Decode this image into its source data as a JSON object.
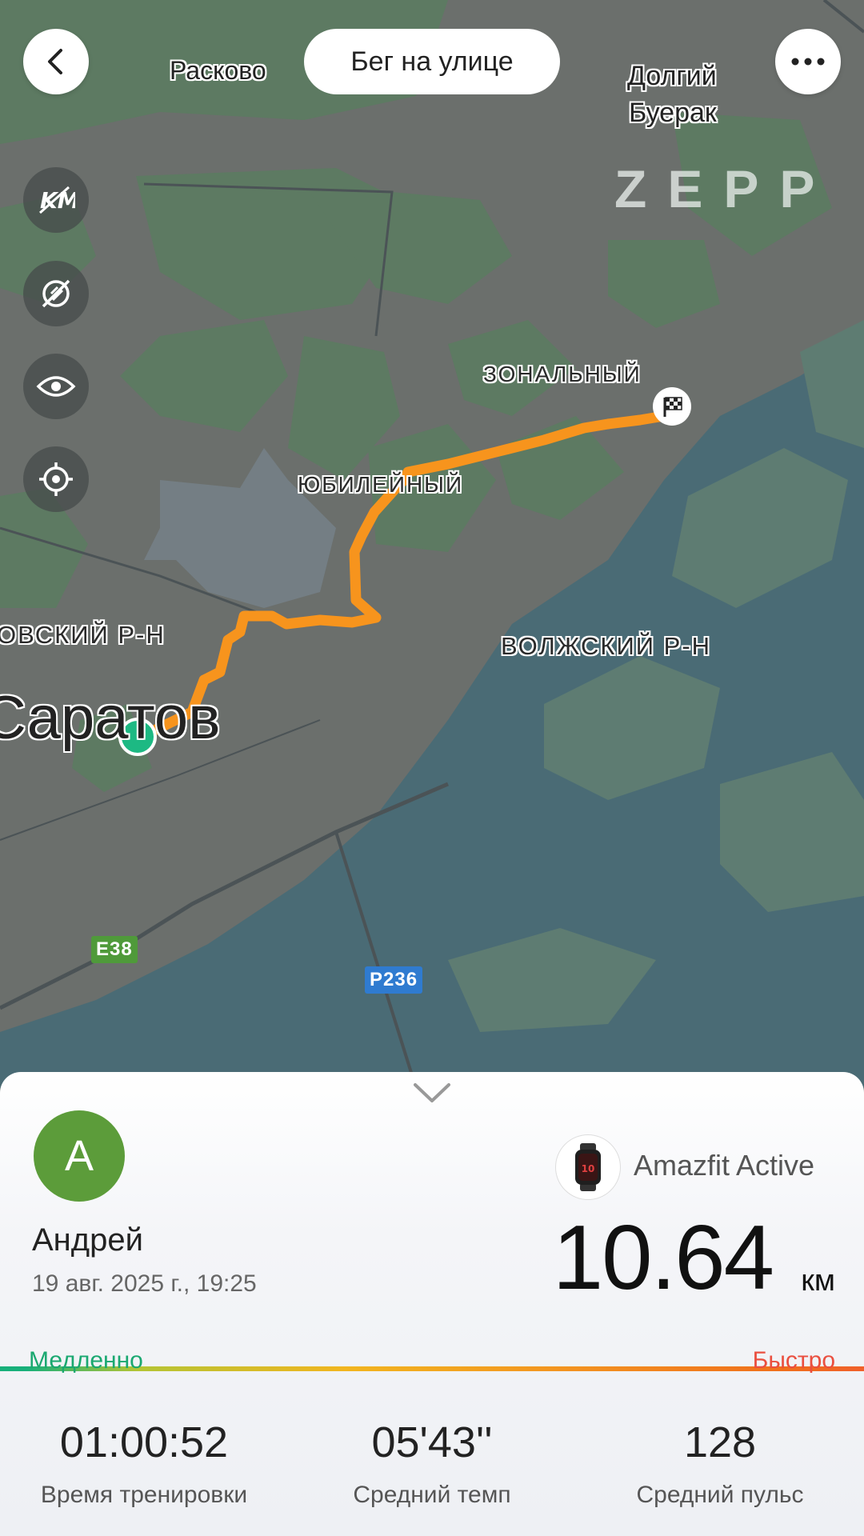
{
  "header": {
    "title": "Бег на улице",
    "back_icon": "chevron-left-icon",
    "more_icon": "more-horizontal-icon"
  },
  "map": {
    "labels": {
      "raskovo": "Расково",
      "dolgiy": "Долгий",
      "buerak": "Буерак",
      "zonalny": "ЗОНАЛЬНЫЙ",
      "yubileyny": "ЮБИЛЕЙНЫЙ",
      "volzhsky": "ВОЛЖСКИЙ Р-Н",
      "leninsky_partial": "ОВСКИЙ Р-Н",
      "saratov": "Саратов",
      "e38": "E38",
      "p236": "P236"
    },
    "watermark": "ZEPP",
    "tools": [
      "km-icon",
      "rotation-off-icon",
      "eye-icon",
      "locate-icon"
    ],
    "route_color": "#f7941d",
    "start_marker_color": "#1db983",
    "finish_icon": "checkered-flag-icon"
  },
  "sheet": {
    "collapse_icon": "chevron-down-icon",
    "avatar_letter": "A",
    "avatar_color": "#5c9c3a",
    "user_name": "Андрей",
    "date": "19 авг. 2025 г., 19:25",
    "device_name": "Amazfit Active",
    "device_icon": "smartwatch-icon",
    "distance": "10.64",
    "distance_unit": "км",
    "pace_slow_label": "Медленно",
    "pace_fast_label": "Быстро",
    "stats": [
      {
        "value": "01:00:52",
        "label": "Время тренировки"
      },
      {
        "value": "05'43''",
        "label": "Средний темп"
      },
      {
        "value": "128",
        "label": "Средний пульс"
      }
    ]
  }
}
